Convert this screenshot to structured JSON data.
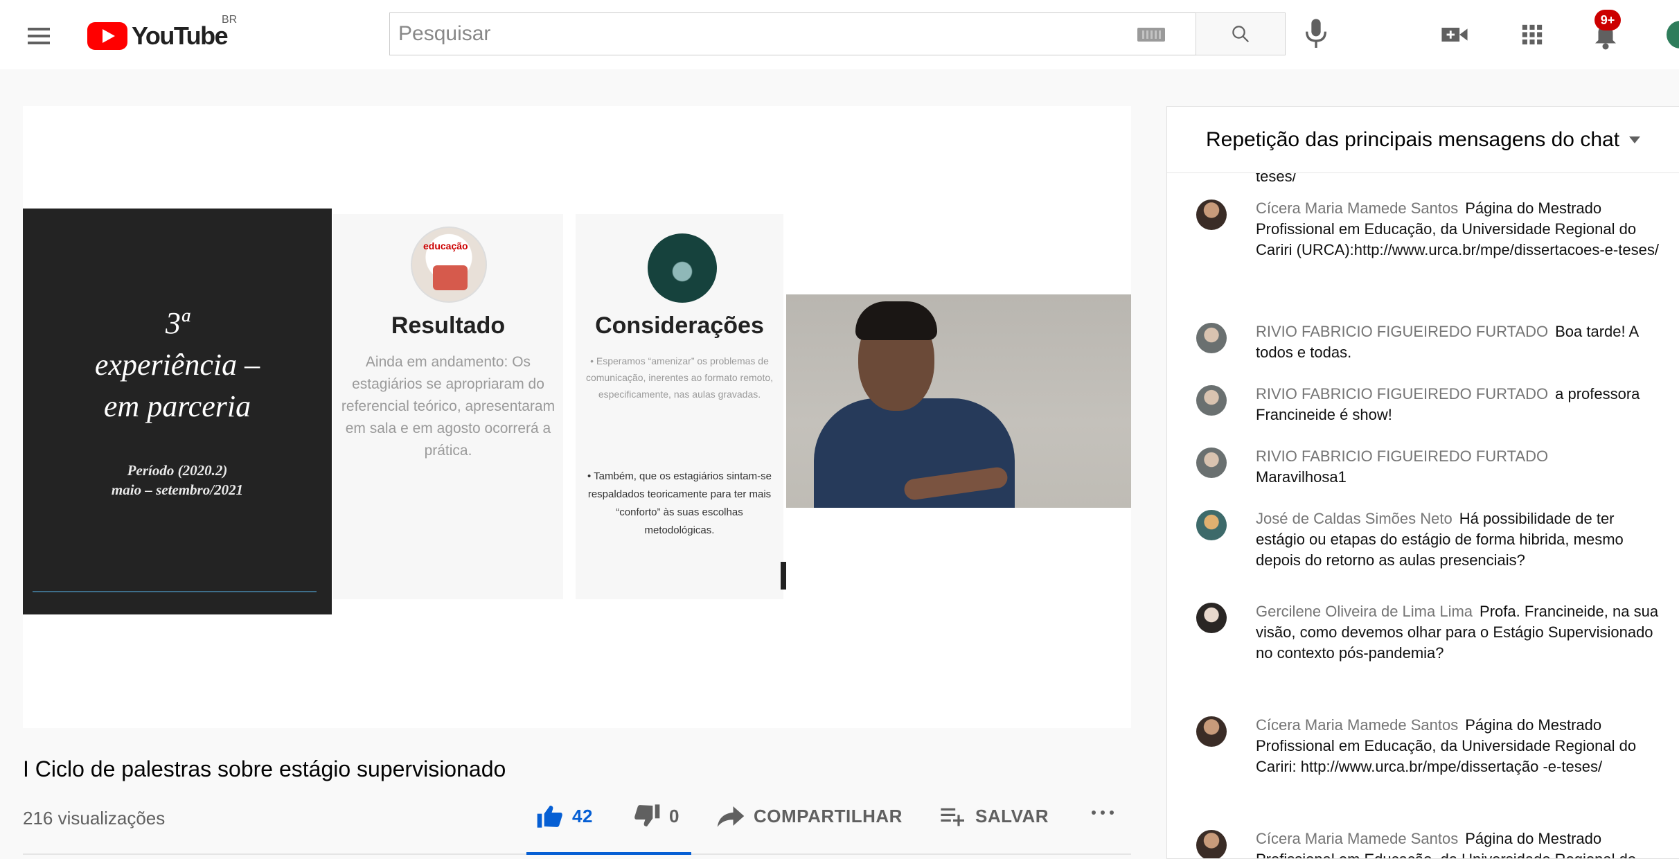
{
  "header": {
    "logo_text": "YouTube",
    "country": "BR",
    "search_placeholder": "Pesquisar",
    "notification_count": "9+"
  },
  "player": {
    "slide": {
      "exp_line1": "3ª",
      "exp_line2": "experiência –",
      "exp_line3": "em parceria",
      "period_line1": "Período (2020.2)",
      "period_line2": "maio – setembro/2021",
      "col1_title": "Resultado",
      "col1_body": "Ainda em andamento: Os estagiários se apropriaram do referencial teórico, apresentaram em sala e em agosto ocorrerá a prática.",
      "col2_title": "Considerações",
      "col2_body1": "• Esperamos “amenizar” os problemas de comunicação, inerentes ao formato remoto, especificamente, nas aulas gravadas.",
      "col2_body2": "• Também, que os estagiários sintam-se respaldados teoricamente para ter mais “conforto” às suas escolhas metodológicas."
    }
  },
  "video": {
    "title": "I Ciclo de palestras sobre estágio supervisionado",
    "views": "216 visualizações",
    "likes": "42",
    "dislikes": "0",
    "share_label": "COMPARTILHAR",
    "save_label": "SALVAR",
    "like_ratio": 1.0
  },
  "chat": {
    "header": "Repetição das principais mensagens do chat",
    "cut_text": "teses/",
    "messages": [
      {
        "author": "Cícera Maria Mamede Santos",
        "text": "Página do Mestrado Profissional em Educação, da Universidade Regional do Cariri (URCA):http://www.urca.br/mpe/dissertacoes-e-teses/"
      },
      {
        "author": "RIVIO FABRICIO FIGUEIREDO FURTADO",
        "text": "Boa tarde! A todos e todas."
      },
      {
        "author": "RIVIO FABRICIO FIGUEIREDO FURTADO",
        "text": "a professora Francineide é show!"
      },
      {
        "author": "RIVIO FABRICIO FIGUEIREDO FURTADO",
        "text": "Maravilhosa1"
      },
      {
        "author": "José de Caldas Simões Neto",
        "text": "Há possibilidade de ter estágio ou etapas do estágio de forma hibrida, mesmo depois do retorno as aulas presenciais?"
      },
      {
        "author": "Gercilene Oliveira de Lima Lima",
        "text": "Profa. Francineide, na sua visão, como devemos olhar para o Estágio Supervisionado no contexto pós-pandemia?"
      },
      {
        "author": "Cícera Maria Mamede Santos",
        "text": "Página do Mestrado Profissional em Educação, da Universidade Regional do Cariri: http://www.urca.br/mpe/dissertação -e-teses/"
      },
      {
        "author": "Cícera Maria Mamede Santos",
        "text": "Página do Mestrado Profissional em Educação, da Universidade Regional do Cariri (URCA):http://www.urca.br/mpe/dissertacoes-e-"
      }
    ]
  },
  "colors": {
    "brand_red": "#ff0000",
    "link_blue": "#065fd4",
    "badge_red": "#cc0000"
  },
  "icons": {
    "menu": "hamburger-menu-icon",
    "keyboard": "keyboard-icon",
    "search": "search-icon",
    "mic": "microphone-icon",
    "create": "video-camera-plus-icon",
    "apps": "apps-grid-icon",
    "notifications": "bell-icon",
    "like": "thumbs-up-icon",
    "dislike": "thumbs-down-icon",
    "share": "share-arrow-icon",
    "save": "playlist-add-icon",
    "more": "more-dots-icon"
  }
}
